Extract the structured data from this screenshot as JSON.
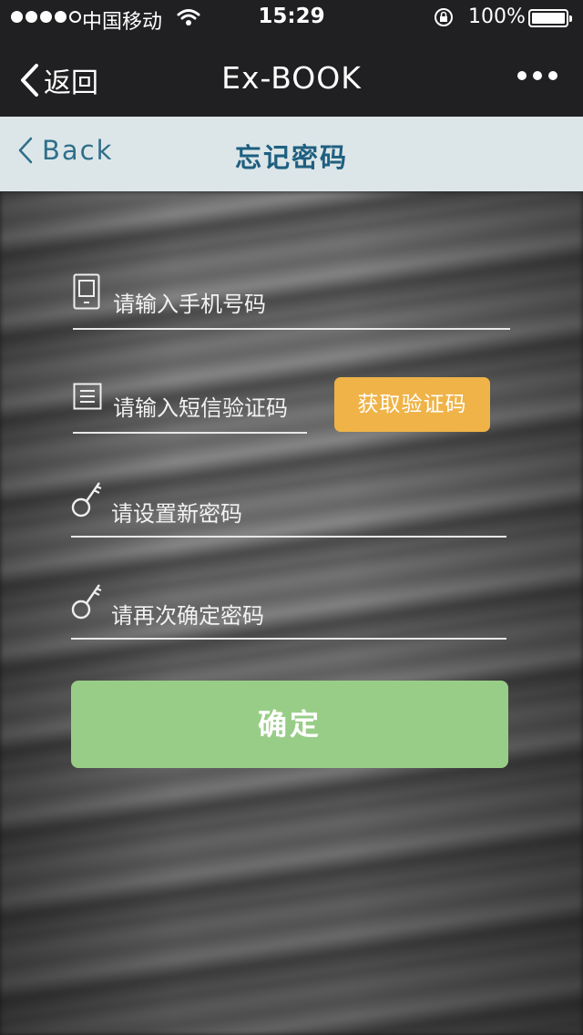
{
  "status_bar": {
    "carrier": "中国移动",
    "time": "15:29",
    "battery_percent": "100%",
    "signal_bars_filled": 4,
    "signal_bars_total": 5
  },
  "wechat_nav": {
    "back_label": "返回",
    "title": "Ex-BOOK"
  },
  "page_header": {
    "back_label": "Back",
    "title": "忘记密码"
  },
  "form": {
    "phone_placeholder": "请输入手机号码",
    "code_placeholder": "请输入短信验证码",
    "get_code_label": "获取验证码",
    "new_password_placeholder": "请设置新密码",
    "confirm_password_placeholder": "请再次确定密码",
    "confirm_label": "确定"
  },
  "colors": {
    "nav_bg": "#202022",
    "header_bg": "#dce6e8",
    "header_text": "#1e5f80",
    "get_code_button": "#efb347",
    "confirm_button": "#98cd87"
  },
  "icons": {
    "phone_field": "mobile-phone-icon",
    "code_field": "document-lines-icon",
    "password_field": "key-icon"
  }
}
